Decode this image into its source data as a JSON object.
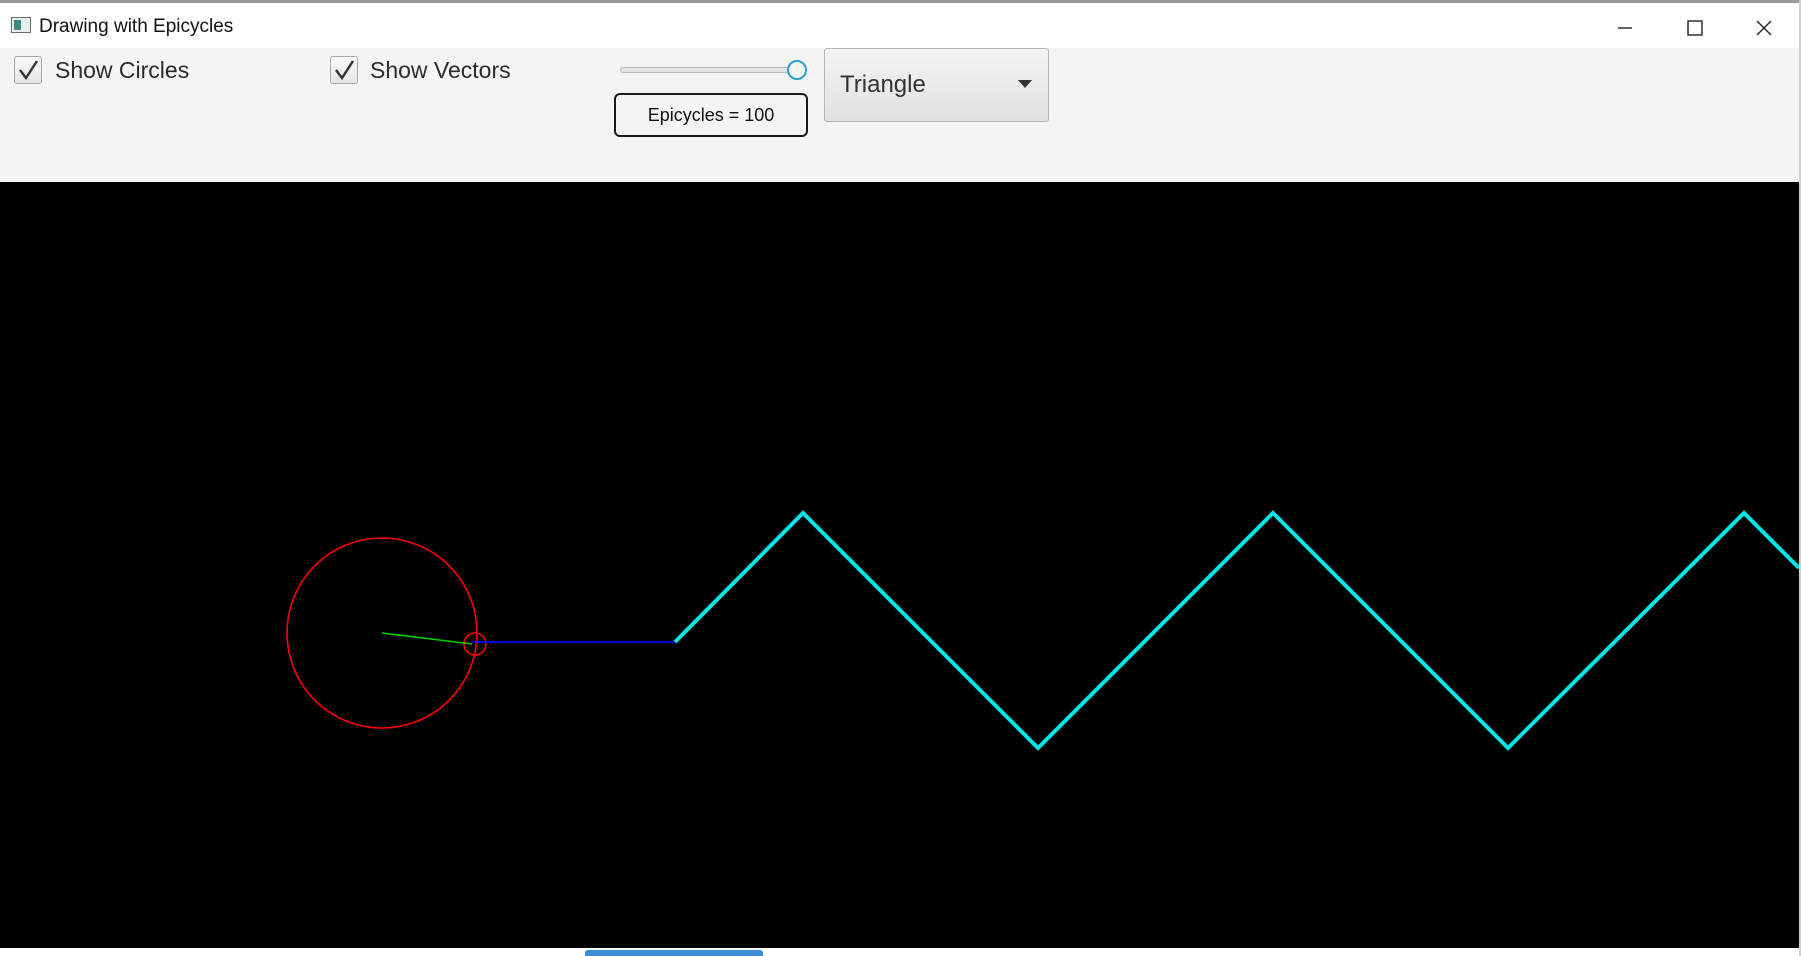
{
  "window": {
    "title": "Drawing with Epicycles"
  },
  "controls": {
    "show_circles": {
      "label": "Show Circles",
      "checked": true
    },
    "show_vectors": {
      "label": "Show Vectors",
      "checked": true
    },
    "epicycles_slider": {
      "value": 100,
      "min": 0,
      "max": 100,
      "readout": "Epicycles = 100"
    },
    "shape_select": {
      "selected": "Triangle"
    }
  },
  "colors": {
    "canvas_background": "#000000",
    "trace": "#00e5e5",
    "circles": "#ff0000",
    "vector_main": "#00d000",
    "vector_link": "#0000ff",
    "slider_accent": "#2aa0cf"
  },
  "icons": {
    "minimize": "minimize-icon",
    "maximize": "maximize-icon",
    "close": "close-icon",
    "checkmark": "checkmark-icon",
    "dropdown": "chevron-down-icon"
  }
}
